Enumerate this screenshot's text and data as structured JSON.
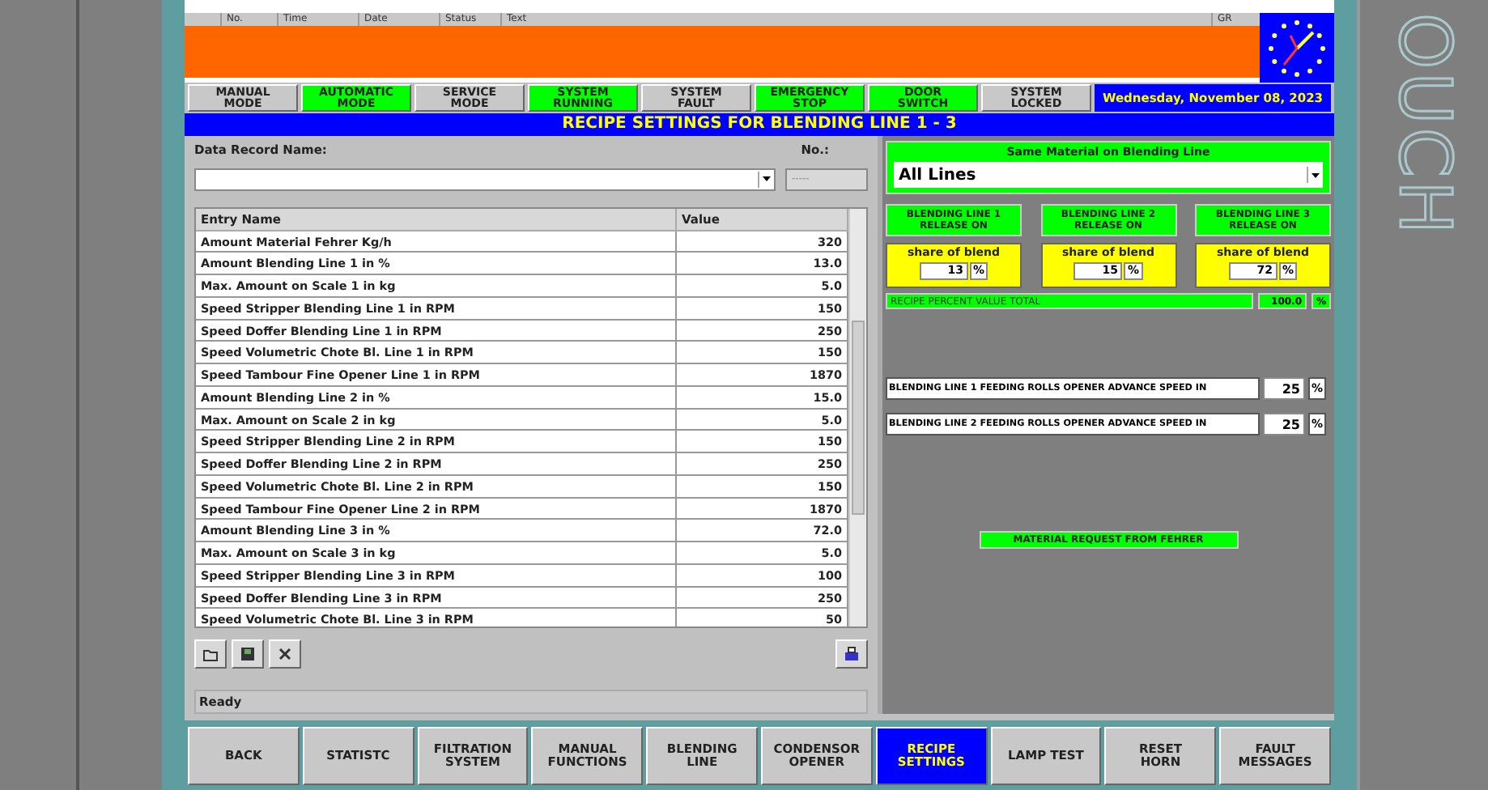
{
  "alarm_header": {
    "columns": [
      "No.",
      "Time",
      "Date",
      "Status",
      "Text",
      "GR"
    ]
  },
  "status_buttons": [
    {
      "label": "MANUAL\nMODE",
      "on": false
    },
    {
      "label": "AUTOMATIC\nMODE",
      "on": true
    },
    {
      "label": "SERVICE\nMODE",
      "on": false
    },
    {
      "label": "SYSTEM\nRUNNING",
      "on": true
    },
    {
      "label": "SYSTEM\nFAULT",
      "on": false
    },
    {
      "label": "EMERGENCY\nSTOP",
      "on": true
    },
    {
      "label": "DOOR\nSWITCH",
      "on": true
    },
    {
      "label": "SYSTEM\nLOCKED",
      "on": false
    }
  ],
  "date": "Wednesday, November 08, 2023",
  "title": "RECIPE SETTINGS FOR BLENDING LINE 1 - 3",
  "record": {
    "name_label": "Data Record Name:",
    "no_label": "No.:",
    "no_value": "-----"
  },
  "table": {
    "columns": [
      "Entry Name",
      "Value"
    ],
    "rows": [
      {
        "name": "Amount Material Fehrer Kg/h",
        "value": "320"
      },
      {
        "name": "Amount Blending Line 1 in %",
        "value": "13.0"
      },
      {
        "name": "Max. Amount on Scale 1 in kg",
        "value": "5.0"
      },
      {
        "name": "Speed Stripper Blending Line 1 in RPM",
        "value": "150"
      },
      {
        "name": "Speed Doffer Blending Line 1 in RPM",
        "value": "250"
      },
      {
        "name": "Speed Volumetric Chote Bl. Line 1 in RPM",
        "value": "150"
      },
      {
        "name": "Speed Tambour Fine Opener Line 1 in RPM",
        "value": "1870"
      },
      {
        "name": "Amount Blending Line 2 in %",
        "value": "15.0"
      },
      {
        "name": "Max. Amount on Scale 2 in kg",
        "value": "5.0"
      },
      {
        "name": "Speed Stripper Blending Line 2 in RPM",
        "value": "150"
      },
      {
        "name": "Speed Doffer Blending Line 2 in RPM",
        "value": "250"
      },
      {
        "name": "Speed Volumetric Chote Bl. Line 2 in RPM",
        "value": "150"
      },
      {
        "name": "Speed Tambour Fine Opener Line 2 in RPM",
        "value": "1870"
      },
      {
        "name": "Amount Blending Line 3 in %",
        "value": "72.0"
      },
      {
        "name": "Max. Amount on Scale 3 in kg",
        "value": "5.0"
      },
      {
        "name": "Speed Stripper Blending Line 3 in RPM",
        "value": "100"
      },
      {
        "name": "Speed Doffer Blending Line 3 in RPM",
        "value": "250"
      },
      {
        "name": "Speed Volumetric Chote Bl. Line 3 in RPM",
        "value": "50"
      }
    ]
  },
  "status_text": "Ready",
  "same_material": {
    "label": "Same Material on Blending Line",
    "value": "All Lines"
  },
  "lines": [
    {
      "release": "BLENDING LINE 1\nRELEASE ON",
      "share_label": "share of blend",
      "share": "13",
      "unit": "%"
    },
    {
      "release": "BLENDING LINE 2\nRELEASE ON",
      "share_label": "share of blend",
      "share": "15",
      "unit": "%"
    },
    {
      "release": "BLENDING LINE 3\nRELEASE ON",
      "share_label": "share of blend",
      "share": "72",
      "unit": "%"
    }
  ],
  "total": {
    "label": "RECIPE PERCENT VALUE TOTAL",
    "value": "100.0",
    "unit": "%"
  },
  "speeds": [
    {
      "label": "BLENDING LINE 1 FEEDING ROLLS OPENER ADVANCE SPEED IN",
      "value": "25",
      "unit": "%"
    },
    {
      "label": "BLENDING LINE 2 FEEDING ROLLS OPENER ADVANCE SPEED IN",
      "value": "25",
      "unit": "%"
    }
  ],
  "material_request": "MATERIAL REQUEST FROM FEHRER",
  "nav": [
    {
      "label": "BACK",
      "selected": false
    },
    {
      "label": "STATISTC",
      "selected": false
    },
    {
      "label": "FILTRATION\nSYSTEM",
      "selected": false
    },
    {
      "label": "MANUAL\nFUNCTIONS",
      "selected": false
    },
    {
      "label": "BLENDING\nLINE",
      "selected": false
    },
    {
      "label": "CONDENSOR\nOPENER",
      "selected": false
    },
    {
      "label": "RECIPE\nSETTINGS",
      "selected": true
    },
    {
      "label": "LAMP TEST",
      "selected": false
    },
    {
      "label": "RESET\nHORN",
      "selected": false
    },
    {
      "label": "FAULT\nMESSAGES",
      "selected": false
    }
  ],
  "side_text": "OUCH"
}
